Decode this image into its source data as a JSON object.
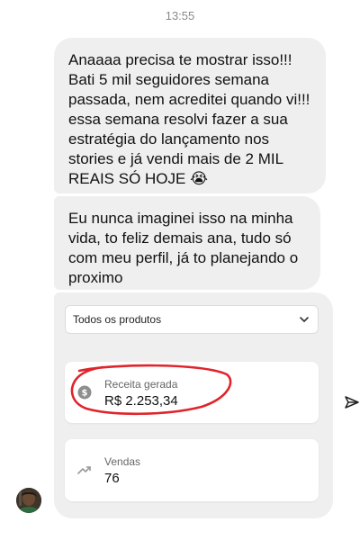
{
  "status": {
    "time": "13:55"
  },
  "messages": [
    {
      "text": "Anaaaa precisa te mostrar isso!!! Bati 5 mil seguidores semana passada, nem acreditei quando vi!!! essa semana resolvi fazer a sua estratégia do lançamento nos stories e já vendi mais de 2 MIL REAIS SÓ HOJE 😭"
    },
    {
      "text": "Eu nunca imaginei isso na minha vida, to feliz demais ana, tudo só com meu perfil, já to planejando o proximo"
    }
  ],
  "dashboard": {
    "filter": {
      "selected": "Todos os produtos"
    },
    "revenue": {
      "label": "Receita gerada",
      "value": "R$ 2.253,34",
      "icon": "dollar-coin-icon"
    },
    "sales": {
      "label": "Vendas",
      "value": "76",
      "icon": "trending-up-icon"
    }
  },
  "colors": {
    "bubble_bg": "#efefef",
    "highlight_ring": "#e0242b"
  }
}
